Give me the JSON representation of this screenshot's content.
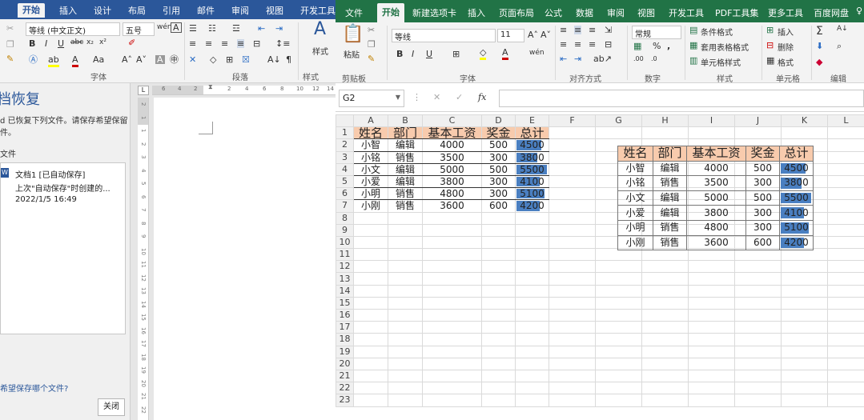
{
  "word": {
    "tabs": [
      "开始",
      "插入",
      "设计",
      "布局",
      "引用",
      "邮件",
      "审阅",
      "视图",
      "开发工具"
    ],
    "font_name": "等线 (中文正文)",
    "font_size": "五号",
    "group_labels": [
      "字体",
      "段落",
      "样式"
    ],
    "styles_label": "样式",
    "ruler_marks": [
      "6",
      "4",
      "2",
      "2",
      "4",
      "6",
      "8",
      "10",
      "12",
      "14"
    ],
    "vruler_marks": [
      "2",
      "1",
      "1",
      "2",
      "3",
      "4",
      "5",
      "6",
      "7",
      "8",
      "9",
      "10",
      "11",
      "12",
      "13",
      "14",
      "15",
      "16",
      "17",
      "18",
      "19",
      "20",
      "21",
      "22"
    ],
    "recovery": {
      "title": "档恢复",
      "desc1": "d 已恢复下列文件。请保存希望保留",
      "desc2": "件。",
      "section": "文件",
      "file_name": "文档1  [已自动保存]",
      "file_detail": "上次\"自动保存\"时创建的...",
      "file_date": "2022/1/5 16:49",
      "question": "希望保存哪个文件?",
      "close": "关闭"
    }
  },
  "excel": {
    "tabs": [
      "文件",
      "开始",
      "新建选项卡",
      "插入",
      "页面布局",
      "公式",
      "数据",
      "审阅",
      "视图",
      "开发工具",
      "PDF工具集",
      "更多工具",
      "百度网盘"
    ],
    "font_name": "等线",
    "font_size": "11",
    "number_format": "常规",
    "ribbon": {
      "paste": "粘贴",
      "cond_format": "条件格式",
      "table_format": "套用表格格式",
      "cell_style": "单元格样式",
      "insert": "插入",
      "delete": "删除",
      "format": "格式"
    },
    "group_labels": [
      "剪贴板",
      "字体",
      "对齐方式",
      "数字",
      "样式",
      "单元格",
      "编辑"
    ],
    "name_box": "G2",
    "formula": "",
    "columns": [
      "A",
      "B",
      "C",
      "D",
      "E",
      "F",
      "G",
      "H",
      "I",
      "J",
      "K",
      "L"
    ],
    "rows": [
      "1",
      "2",
      "3",
      "4",
      "5",
      "6",
      "7",
      "8",
      "9",
      "10",
      "11",
      "12",
      "13",
      "14",
      "15",
      "16",
      "17",
      "18",
      "19",
      "20",
      "21",
      "22",
      "23"
    ],
    "headers": [
      "姓名",
      "部门",
      "基本工资",
      "奖金",
      "总计"
    ],
    "data": [
      [
        "小智",
        "编辑",
        "4000",
        "500",
        "4500"
      ],
      [
        "小铭",
        "销售",
        "3500",
        "300",
        "3800"
      ],
      [
        "小文",
        "编辑",
        "5000",
        "500",
        "5500"
      ],
      [
        "小爱",
        "编辑",
        "3800",
        "300",
        "4100"
      ],
      [
        "小明",
        "销售",
        "4800",
        "300",
        "5100"
      ],
      [
        "小刚",
        "销售",
        "3600",
        "600",
        "4200"
      ]
    ],
    "bar_fraction": [
      0.82,
      0.69,
      1.0,
      0.75,
      0.93,
      0.76
    ]
  }
}
